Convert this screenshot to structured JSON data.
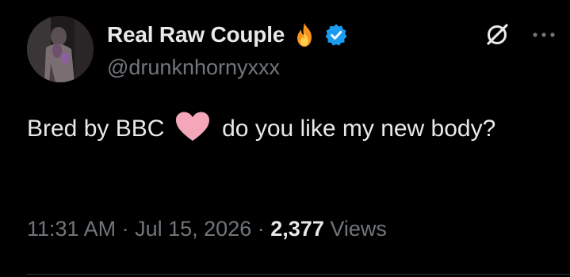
{
  "post": {
    "author": {
      "display_name": "Real Raw Couple",
      "handle": "@drunknhornyxxx",
      "badge_emoji_icon": "fire-icon",
      "verified_icon": "verified-badge-icon",
      "verified_color": "#1d9bf0"
    },
    "text_part1": "Bred by BBC",
    "heart_icon": "pink-heart-icon",
    "heart_color": "#f4a7b9",
    "text_part2": "do you like my new body?",
    "time": "11:31 AM",
    "date": "Jul 15, 2026",
    "separator": "·",
    "views_count": "2,377",
    "views_label": "Views"
  },
  "toolbar": {
    "grok_icon": "grok-icon",
    "more_icon": "more-options-icon"
  },
  "colors": {
    "background": "#000000",
    "text_primary": "#e7e9ea",
    "text_secondary": "#71767b"
  }
}
